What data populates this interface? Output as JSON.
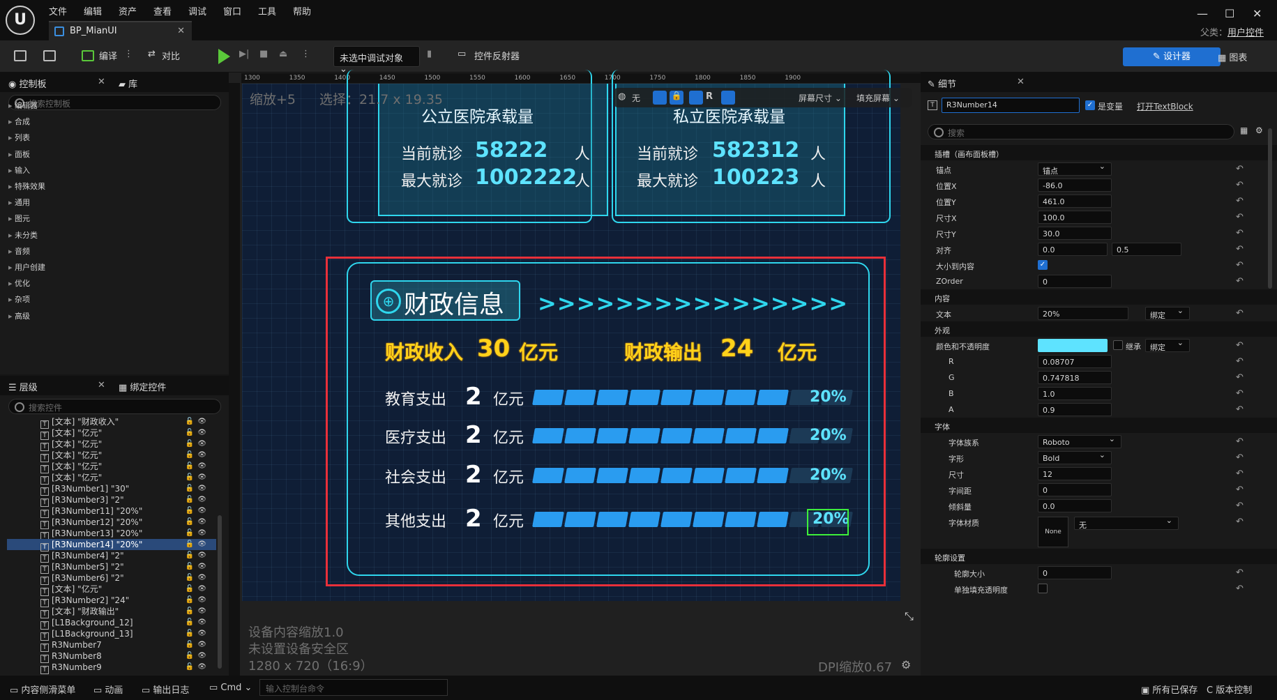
{
  "menu": [
    "文件",
    "编辑",
    "资产",
    "查看",
    "调试",
    "窗口",
    "工具",
    "帮助"
  ],
  "doc_tab": "BP_MianUI",
  "parent_label": "父类：",
  "parent_value": "用户控件",
  "toolbar": {
    "compile": "编译",
    "diff": "对比",
    "debug_select": "未选中调试对象",
    "reflector": "控件反射器",
    "designer": "设计器",
    "graph": "图表"
  },
  "palette": {
    "tab": "控制板",
    "lib_tab": "库",
    "search": "搜索控制板",
    "categories": [
      "编辑器",
      "合成",
      "列表",
      "面板",
      "输入",
      "特殊效果",
      "通用",
      "图元",
      "未分类",
      "音频",
      "用户创建",
      "优化",
      "杂项",
      "高级"
    ]
  },
  "hierarchy": {
    "tab": "层级",
    "bind_tab": "绑定控件",
    "search": "搜索控件",
    "items": [
      "[文本] \"财政收入\"",
      "[文本] \"亿元\"",
      "[文本] \"亿元\"",
      "[文本] \"亿元\"",
      "[文本] \"亿元\"",
      "[文本] \"亿元\"",
      "[R3Number1] \"30\"",
      "[R3Number3] \"2\"",
      "[R3Number11] \"20%\"",
      "[R3Number12] \"20%\"",
      "[R3Number13] \"20%\"",
      "[R3Number14] \"20%\"",
      "[R3Number4] \"2\"",
      "[R3Number5] \"2\"",
      "[R3Number6] \"2\"",
      "[文本] \"亿元\"",
      "[R3Number2] \"24\"",
      "[文本] \"财政输出\"",
      "[L1Background_12]",
      "[L1Background_13]",
      "R3Number7",
      "R3Number8",
      "R3Number9"
    ],
    "selected": 11
  },
  "canvas": {
    "zoom": "缩放+5",
    "selection": "选择：21.7 x 19.35",
    "ruler": [
      "1300",
      "1350",
      "1400",
      "1450",
      "1500",
      "1550",
      "1600",
      "1650",
      "1700",
      "1750",
      "1800",
      "1850",
      "1900"
    ],
    "btn_none": "无",
    "btn_r": "R",
    "btn_screen": "屏幕尺寸",
    "btn_fill": "填充屏幕",
    "device_scale": "设备内容缩放1.0",
    "safe_zone": "未设置设备安全区",
    "resolution": "1280 x 720（16:9）",
    "dpi": "DPI缩放0.67"
  },
  "hud": {
    "public_title": "公立医院承载量",
    "private_title": "私立医院承载量",
    "current": "当前就诊",
    "max": "最大就诊",
    "unit_person": "人",
    "pub_cur": "58222",
    "pub_max": "1002222",
    "pri_cur": "582312",
    "pri_max": "100223",
    "fin_title": "财政信息",
    "arrows": ">>>>>>>>>>>>>>>>",
    "income_lbl": "财政收入",
    "income_val": "30",
    "income_unit": "亿元",
    "output_lbl": "财政输出",
    "output_val": "24",
    "output_unit": "亿元",
    "unit_yi": "亿元",
    "rows": [
      {
        "label": "教育支出",
        "num": "2",
        "pct": "20%",
        "fill": 0.8
      },
      {
        "label": "医疗支出",
        "num": "2",
        "pct": "20%",
        "fill": 0.8
      },
      {
        "label": "社会支出",
        "num": "2",
        "pct": "20%",
        "fill": 0.8
      },
      {
        "label": "其他支出",
        "num": "2",
        "pct": "20%",
        "fill": 0.8
      }
    ]
  },
  "details": {
    "tab": "细节",
    "name": "R3Number14",
    "is_var": "是变量",
    "open_tb": "打开TextBlock",
    "search": "搜索",
    "slot_sect": "插槽（画布面板槽）",
    "anchor": "锚点",
    "anchor_val": "锚点",
    "pos_x": "位置X",
    "pos_x_val": "-86.0",
    "pos_y": "位置Y",
    "pos_y_val": "461.0",
    "size_x": "尺寸X",
    "size_x_val": "100.0",
    "size_y": "尺寸Y",
    "size_y_val": "30.0",
    "align": "对齐",
    "align_a": "0.0",
    "align_b": "0.5",
    "autosize": "大小到内容",
    "zorder": "ZOrder",
    "zorder_val": "0",
    "content_sect": "内容",
    "text": "文本",
    "text_val": "20%",
    "bind": "绑定",
    "look_sect": "外观",
    "color": "颜色和不透明度",
    "inherit": "继承",
    "r": "R",
    "r_val": "0.08707",
    "g": "G",
    "g_val": "0.747818",
    "b": "B",
    "b_val": "1.0",
    "a": "A",
    "a_val": "0.9",
    "font_sect": "字体",
    "font_family": "字体族系",
    "font_family_val": "Roboto",
    "typeface": "字形",
    "typeface_val": "Bold",
    "size": "尺寸",
    "size_val": "12",
    "spacing": "字间距",
    "spacing_val": "0",
    "skew": "倾斜量",
    "skew_val": "0.0",
    "material": "字体材质",
    "material_none": "None",
    "material_val": "无",
    "outline_sect": "轮廓设置",
    "outline_size": "轮廓大小",
    "outline_size_val": "0",
    "separate_fill": "单独填充透明度"
  },
  "status": {
    "drawer": "内容侧滑菜单",
    "anim": "动画",
    "log": "输出日志",
    "cmd": "Cmd",
    "cmd_placeholder": "输入控制台命令",
    "saved": "所有已保存",
    "source": "C 版本控制"
  },
  "colors": {
    "accent": "#1f6fd1",
    "hud_cyan": "#2fd7ee",
    "hud_yellow": "#ffd21a",
    "tint": "#5ee3ff"
  }
}
